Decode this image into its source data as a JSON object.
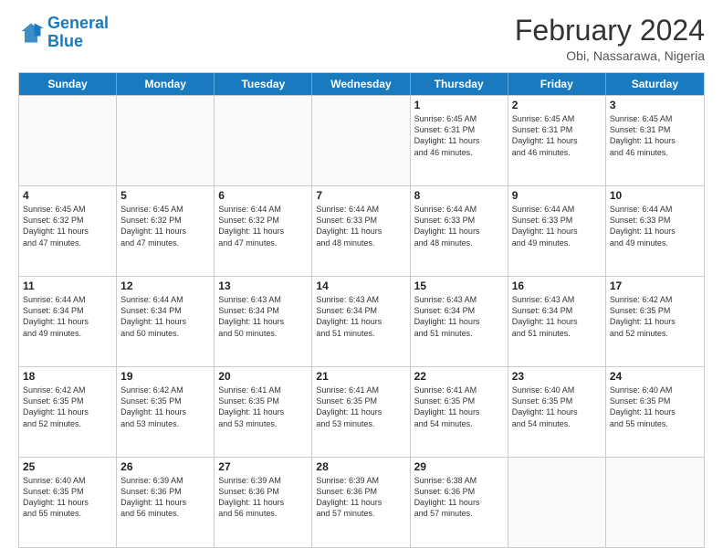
{
  "header": {
    "logo_general": "General",
    "logo_blue": "Blue",
    "month_year": "February 2024",
    "location": "Obi, Nassarawa, Nigeria"
  },
  "days_of_week": [
    "Sunday",
    "Monday",
    "Tuesday",
    "Wednesday",
    "Thursday",
    "Friday",
    "Saturday"
  ],
  "weeks": [
    [
      {
        "day": "",
        "text": ""
      },
      {
        "day": "",
        "text": ""
      },
      {
        "day": "",
        "text": ""
      },
      {
        "day": "",
        "text": ""
      },
      {
        "day": "1",
        "text": "Sunrise: 6:45 AM\nSunset: 6:31 PM\nDaylight: 11 hours\nand 46 minutes."
      },
      {
        "day": "2",
        "text": "Sunrise: 6:45 AM\nSunset: 6:31 PM\nDaylight: 11 hours\nand 46 minutes."
      },
      {
        "day": "3",
        "text": "Sunrise: 6:45 AM\nSunset: 6:31 PM\nDaylight: 11 hours\nand 46 minutes."
      }
    ],
    [
      {
        "day": "4",
        "text": "Sunrise: 6:45 AM\nSunset: 6:32 PM\nDaylight: 11 hours\nand 47 minutes."
      },
      {
        "day": "5",
        "text": "Sunrise: 6:45 AM\nSunset: 6:32 PM\nDaylight: 11 hours\nand 47 minutes."
      },
      {
        "day": "6",
        "text": "Sunrise: 6:44 AM\nSunset: 6:32 PM\nDaylight: 11 hours\nand 47 minutes."
      },
      {
        "day": "7",
        "text": "Sunrise: 6:44 AM\nSunset: 6:33 PM\nDaylight: 11 hours\nand 48 minutes."
      },
      {
        "day": "8",
        "text": "Sunrise: 6:44 AM\nSunset: 6:33 PM\nDaylight: 11 hours\nand 48 minutes."
      },
      {
        "day": "9",
        "text": "Sunrise: 6:44 AM\nSunset: 6:33 PM\nDaylight: 11 hours\nand 49 minutes."
      },
      {
        "day": "10",
        "text": "Sunrise: 6:44 AM\nSunset: 6:33 PM\nDaylight: 11 hours\nand 49 minutes."
      }
    ],
    [
      {
        "day": "11",
        "text": "Sunrise: 6:44 AM\nSunset: 6:34 PM\nDaylight: 11 hours\nand 49 minutes."
      },
      {
        "day": "12",
        "text": "Sunrise: 6:44 AM\nSunset: 6:34 PM\nDaylight: 11 hours\nand 50 minutes."
      },
      {
        "day": "13",
        "text": "Sunrise: 6:43 AM\nSunset: 6:34 PM\nDaylight: 11 hours\nand 50 minutes."
      },
      {
        "day": "14",
        "text": "Sunrise: 6:43 AM\nSunset: 6:34 PM\nDaylight: 11 hours\nand 51 minutes."
      },
      {
        "day": "15",
        "text": "Sunrise: 6:43 AM\nSunset: 6:34 PM\nDaylight: 11 hours\nand 51 minutes."
      },
      {
        "day": "16",
        "text": "Sunrise: 6:43 AM\nSunset: 6:34 PM\nDaylight: 11 hours\nand 51 minutes."
      },
      {
        "day": "17",
        "text": "Sunrise: 6:42 AM\nSunset: 6:35 PM\nDaylight: 11 hours\nand 52 minutes."
      }
    ],
    [
      {
        "day": "18",
        "text": "Sunrise: 6:42 AM\nSunset: 6:35 PM\nDaylight: 11 hours\nand 52 minutes."
      },
      {
        "day": "19",
        "text": "Sunrise: 6:42 AM\nSunset: 6:35 PM\nDaylight: 11 hours\nand 53 minutes."
      },
      {
        "day": "20",
        "text": "Sunrise: 6:41 AM\nSunset: 6:35 PM\nDaylight: 11 hours\nand 53 minutes."
      },
      {
        "day": "21",
        "text": "Sunrise: 6:41 AM\nSunset: 6:35 PM\nDaylight: 11 hours\nand 53 minutes."
      },
      {
        "day": "22",
        "text": "Sunrise: 6:41 AM\nSunset: 6:35 PM\nDaylight: 11 hours\nand 54 minutes."
      },
      {
        "day": "23",
        "text": "Sunrise: 6:40 AM\nSunset: 6:35 PM\nDaylight: 11 hours\nand 54 minutes."
      },
      {
        "day": "24",
        "text": "Sunrise: 6:40 AM\nSunset: 6:35 PM\nDaylight: 11 hours\nand 55 minutes."
      }
    ],
    [
      {
        "day": "25",
        "text": "Sunrise: 6:40 AM\nSunset: 6:35 PM\nDaylight: 11 hours\nand 55 minutes."
      },
      {
        "day": "26",
        "text": "Sunrise: 6:39 AM\nSunset: 6:36 PM\nDaylight: 11 hours\nand 56 minutes."
      },
      {
        "day": "27",
        "text": "Sunrise: 6:39 AM\nSunset: 6:36 PM\nDaylight: 11 hours\nand 56 minutes."
      },
      {
        "day": "28",
        "text": "Sunrise: 6:39 AM\nSunset: 6:36 PM\nDaylight: 11 hours\nand 57 minutes."
      },
      {
        "day": "29",
        "text": "Sunrise: 6:38 AM\nSunset: 6:36 PM\nDaylight: 11 hours\nand 57 minutes."
      },
      {
        "day": "",
        "text": ""
      },
      {
        "day": "",
        "text": ""
      }
    ]
  ]
}
